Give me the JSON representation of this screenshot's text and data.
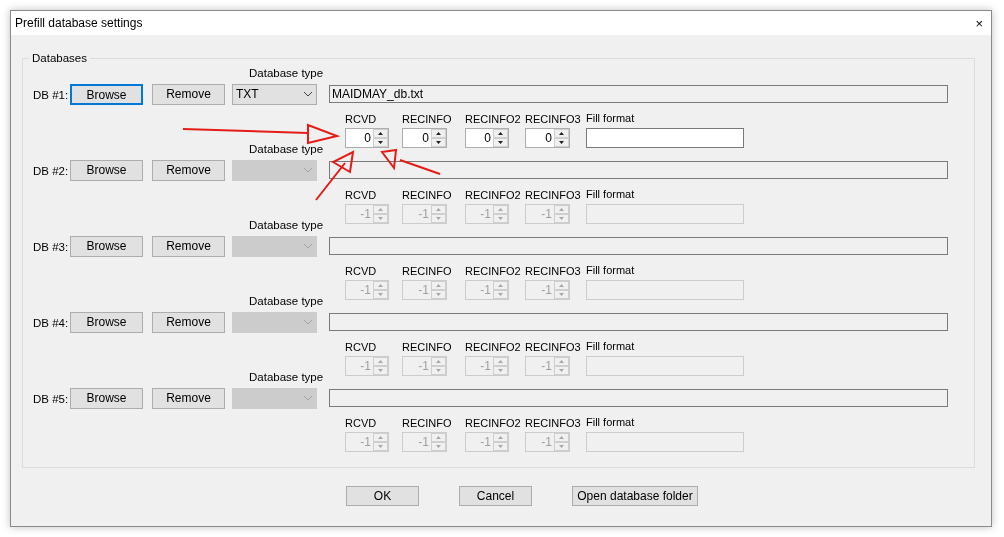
{
  "window": {
    "title": "Prefill database settings",
    "close": "×"
  },
  "group": {
    "title": "Databases"
  },
  "databases": [
    {
      "label": "DB #1:",
      "browse": "Browse",
      "browse_focused": true,
      "remove": "Remove",
      "type_label": "Database type",
      "type": "TXT",
      "path": "MAIDMAY_db.txt",
      "disabled": false,
      "spinners": [
        {
          "label": "RCVD",
          "value": "0"
        },
        {
          "label": "RECINFO",
          "value": "0"
        },
        {
          "label": "RECINFO2",
          "value": "0"
        },
        {
          "label": "RECINFO3",
          "value": "0"
        }
      ],
      "fill_format_label": "Fill format"
    },
    {
      "label": "DB #2:",
      "browse": "Browse",
      "browse_focused": false,
      "remove": "Remove",
      "type_label": "Database type",
      "disabled": true,
      "spinners": [
        {
          "label": "RCVD",
          "value": "-1"
        },
        {
          "label": "RECINFO",
          "value": "-1"
        },
        {
          "label": "RECINFO2",
          "value": "-1"
        },
        {
          "label": "RECINFO3",
          "value": "-1"
        }
      ],
      "fill_format_label": "Fill format"
    },
    {
      "label": "DB #3:",
      "browse": "Browse",
      "browse_focused": false,
      "remove": "Remove",
      "type_label": "Database type",
      "disabled": true,
      "spinners": [
        {
          "label": "RCVD",
          "value": "-1"
        },
        {
          "label": "RECINFO",
          "value": "-1"
        },
        {
          "label": "RECINFO2",
          "value": "-1"
        },
        {
          "label": "RECINFO3",
          "value": "-1"
        }
      ],
      "fill_format_label": "Fill format"
    },
    {
      "label": "DB #4:",
      "browse": "Browse",
      "browse_focused": false,
      "remove": "Remove",
      "type_label": "Database type",
      "disabled": true,
      "spinners": [
        {
          "label": "RCVD",
          "value": "-1"
        },
        {
          "label": "RECINFO",
          "value": "-1"
        },
        {
          "label": "RECINFO2",
          "value": "-1"
        },
        {
          "label": "RECINFO3",
          "value": "-1"
        }
      ],
      "fill_format_label": "Fill format"
    },
    {
      "label": "DB #5:",
      "browse": "Browse",
      "browse_focused": false,
      "remove": "Remove",
      "type_label": "Database type",
      "disabled": true,
      "spinners": [
        {
          "label": "RCVD",
          "value": "-1"
        },
        {
          "label": "RECINFO",
          "value": "-1"
        },
        {
          "label": "RECINFO2",
          "value": "-1"
        },
        {
          "label": "RECINFO3",
          "value": "-1"
        }
      ],
      "fill_format_label": "Fill format"
    }
  ],
  "buttons": [
    "OK",
    "Cancel",
    "Open database folder"
  ]
}
